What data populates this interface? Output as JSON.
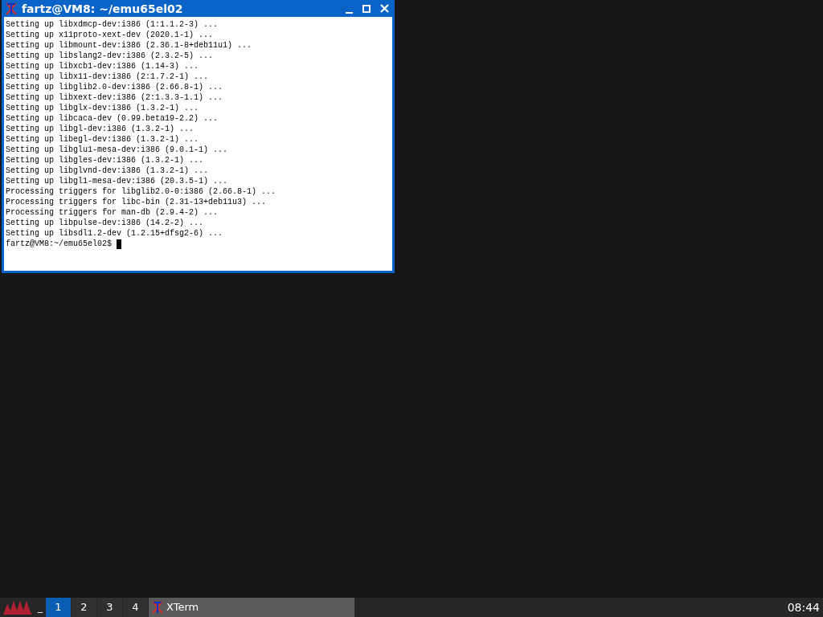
{
  "window": {
    "title": "fartz@VM8: ~/emu65el02"
  },
  "terminal": {
    "lines": [
      "Setting up libxdmcp-dev:i386 (1:1.1.2-3) ...",
      "Setting up x11proto-xext-dev (2020.1-1) ...",
      "Setting up libmount-dev:i386 (2.36.1-8+deb11u1) ...",
      "Setting up libslang2-dev:i386 (2.3.2-5) ...",
      "Setting up libxcb1-dev:i386 (1.14-3) ...",
      "Setting up libx11-dev:i386 (2:1.7.2-1) ...",
      "Setting up libglib2.0-dev:i386 (2.66.8-1) ...",
      "Setting up libxext-dev:i386 (2:1.3.3-1.1) ...",
      "Setting up libglx-dev:i386 (1.3.2-1) ...",
      "Setting up libcaca-dev (0.99.beta19-2.2) ...",
      "Setting up libgl-dev:i386 (1.3.2-1) ...",
      "Setting up libegl-dev:i386 (1.3.2-1) ...",
      "Setting up libglu1-mesa-dev:i386 (9.0.1-1) ...",
      "Setting up libgles-dev:i386 (1.3.2-1) ...",
      "Setting up libglvnd-dev:i386 (1.3.2-1) ...",
      "Setting up libgl1-mesa-dev:i386 (20.3.5-1) ...",
      "Processing triggers for libglib2.0-0:i386 (2.66.8-1) ...",
      "Processing triggers for libc-bin (2.31-13+deb11u3) ...",
      "Processing triggers for man-db (2.9.4-2) ...",
      "Setting up libpulse-dev:i386 (14.2-2) ...",
      "Setting up libsdl1.2-dev (1.2.15+dfsg2-6) ..."
    ],
    "prompt": "fartz@VM8:~/emu65el02$"
  },
  "taskbar": {
    "show_desktop": "_",
    "workspaces": [
      {
        "label": "1",
        "selected": true
      },
      {
        "label": "2",
        "selected": false
      },
      {
        "label": "3",
        "selected": false
      },
      {
        "label": "4",
        "selected": false
      }
    ],
    "tasks": [
      {
        "label": "XTerm",
        "selected": true
      }
    ],
    "clock": "08:44"
  }
}
